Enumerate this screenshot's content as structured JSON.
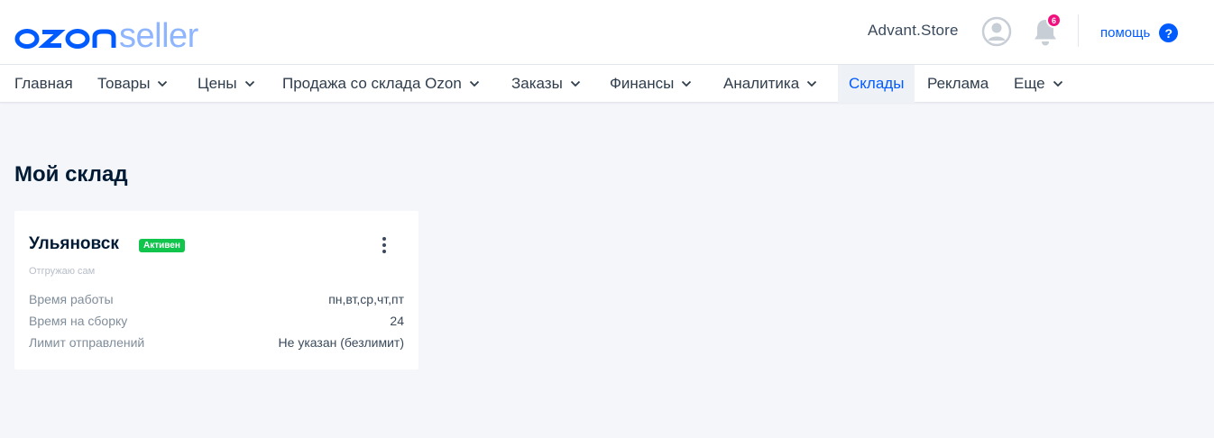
{
  "header": {
    "logo_text": "ozonseller",
    "store_name": "Advant.Store",
    "notifications_count": "6",
    "help_label": "помощь",
    "help_icon_glyph": "?",
    "avatar_icon": "user-avatar-icon",
    "bell_icon": "bell-icon",
    "brand_color": "#005bff"
  },
  "nav": {
    "items": [
      {
        "label": "Главная"
      },
      {
        "label": "Товары"
      },
      {
        "label": "Цены"
      },
      {
        "label": "Продажа со склада Ozon"
      },
      {
        "label": "Заказы"
      },
      {
        "label": "Финансы"
      },
      {
        "label": "Аналитика"
      },
      {
        "label": "Склады"
      },
      {
        "label": "Реклама"
      },
      {
        "label": "Еще"
      }
    ],
    "active": "Склады"
  },
  "page": {
    "title": "Мой склад"
  },
  "warehouse": {
    "city": "Ульяновск",
    "status": "Активен",
    "status_color": "#10c44c",
    "subtitle": "Отгружаю сам",
    "rows": [
      {
        "key": "Время работы",
        "value": "пн,вт,ср,чт,пт"
      },
      {
        "key": "Время на сборку",
        "value": "24"
      },
      {
        "key": "Лимит отправлений",
        "value": "Не указан (безлимит)"
      }
    ]
  }
}
